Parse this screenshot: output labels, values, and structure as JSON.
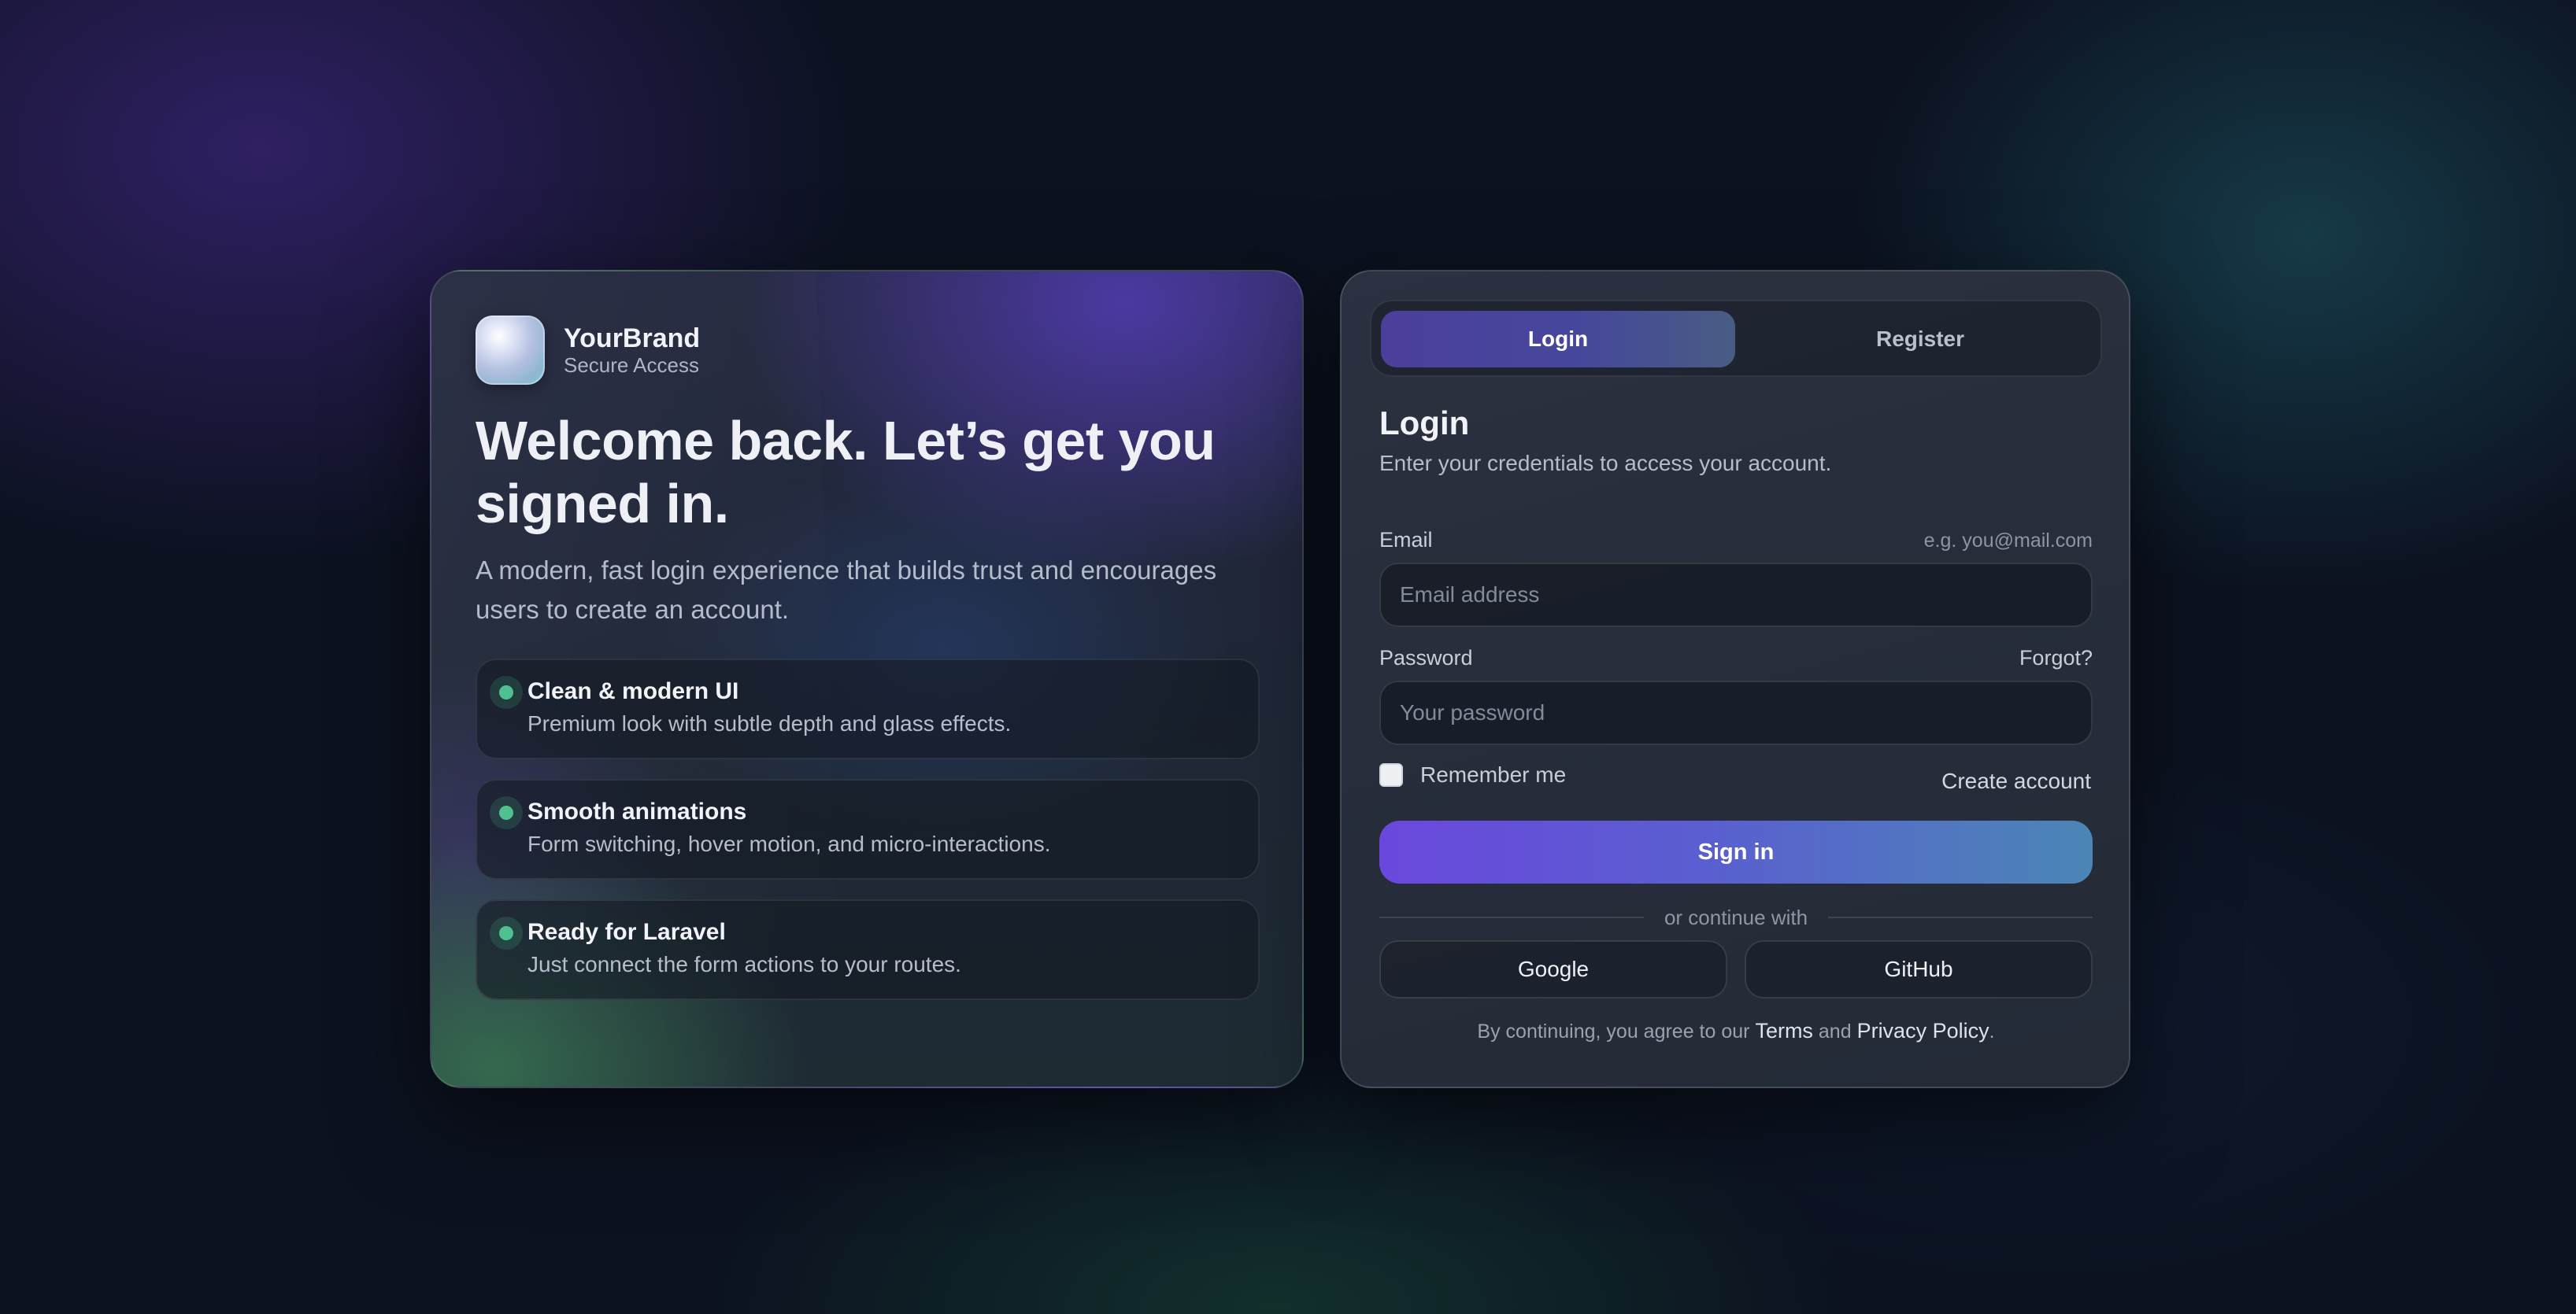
{
  "brand": {
    "name": "YourBrand",
    "tagline": "Secure Access"
  },
  "hero": {
    "title": "Welcome back. Let’s get you signed in.",
    "description": "A modern, fast login experience that builds trust and encourages users to create an account.",
    "features": [
      {
        "title": "Clean & modern UI",
        "description": "Premium look with subtle depth and glass effects."
      },
      {
        "title": "Smooth animations",
        "description": "Form switching, hover motion, and micro-interactions."
      },
      {
        "title": "Ready for Laravel",
        "description": "Just connect the form actions to your routes."
      }
    ]
  },
  "auth": {
    "tabs": {
      "login": "Login",
      "register": "Register",
      "active": "login"
    },
    "title": "Login",
    "subtitle": "Enter your credentials to access your account.",
    "email": {
      "label": "Email",
      "hint": "e.g. you@mail.com",
      "placeholder": "Email address",
      "value": ""
    },
    "password": {
      "label": "Password",
      "forgot": "Forgot?",
      "placeholder": "Your password",
      "value": ""
    },
    "remember_label": "Remember me",
    "remember_checked": false,
    "create_account": "Create account",
    "submit": "Sign in",
    "divider": "or continue with",
    "social": {
      "google": "Google",
      "github": "GitHub"
    },
    "legal": {
      "prefix": "By continuing, you agree to our",
      "terms": "Terms",
      "and": "and",
      "privacy": "Privacy Policy",
      "suffix": "."
    }
  },
  "theme": {
    "accent_purple": "#6a48dd",
    "accent_blue": "#4b86b6",
    "feature_dot": "#4fc08f",
    "background": "#0c1220"
  }
}
